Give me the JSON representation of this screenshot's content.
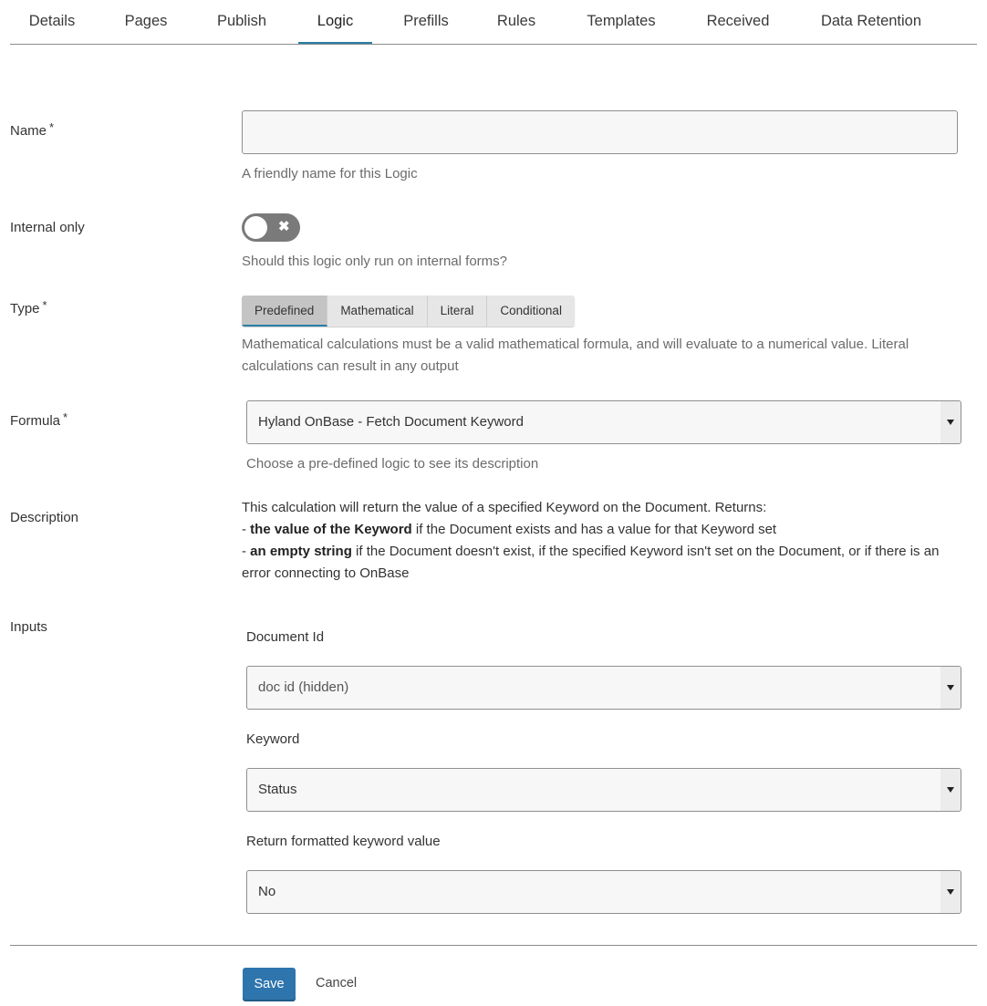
{
  "tabs": [
    {
      "label": "Details",
      "active": false
    },
    {
      "label": "Pages",
      "active": false
    },
    {
      "label": "Publish",
      "active": false
    },
    {
      "label": "Logic",
      "active": true
    },
    {
      "label": "Prefills",
      "active": false
    },
    {
      "label": "Rules",
      "active": false
    },
    {
      "label": "Templates",
      "active": false
    },
    {
      "label": "Received",
      "active": false
    },
    {
      "label": "Data Retention",
      "active": false
    }
  ],
  "form": {
    "required_marker": "*",
    "name": {
      "label": "Name",
      "value": "",
      "help": "A friendly name for this Logic"
    },
    "internal_only": {
      "label": "Internal only",
      "checked": false,
      "off_glyph": "✖",
      "help": "Should this logic only run on internal forms?"
    },
    "type": {
      "label": "Type",
      "options": [
        "Predefined",
        "Mathematical",
        "Literal",
        "Conditional"
      ],
      "selected": "Predefined",
      "help": "Mathematical calculations must be a valid mathematical formula, and will evaluate to a numerical value. Literal calculations can result in any output"
    },
    "formula": {
      "label": "Formula",
      "value": "Hyland OnBase - Fetch Document Keyword",
      "help": "Choose a pre-defined logic to see its description"
    },
    "description": {
      "label": "Description",
      "intro": "This calculation will return the value of a specified Keyword on the Document. Returns:",
      "line1_prefix": "- ",
      "line1_bold": "the value of the Keyword",
      "line1_rest": " if the Document exists and has a value for that Keyword set",
      "line2_prefix": "- ",
      "line2_bold": "an empty string",
      "line2_rest": " if the Document doesn't exist, if the specified Keyword isn't set on the Document, or if there is an error connecting to OnBase"
    },
    "inputs": {
      "label": "Inputs",
      "document_id": {
        "label": "Document Id",
        "value": "doc id (hidden)"
      },
      "keyword": {
        "label": "Keyword",
        "value": "Status"
      },
      "return_formatted": {
        "label": "Return formatted keyword value",
        "value": "No"
      }
    }
  },
  "actions": {
    "save_label": "Save",
    "cancel_label": "Cancel"
  },
  "colors": {
    "accent": "#2a7fa5",
    "save_button": "#2e75ad"
  }
}
